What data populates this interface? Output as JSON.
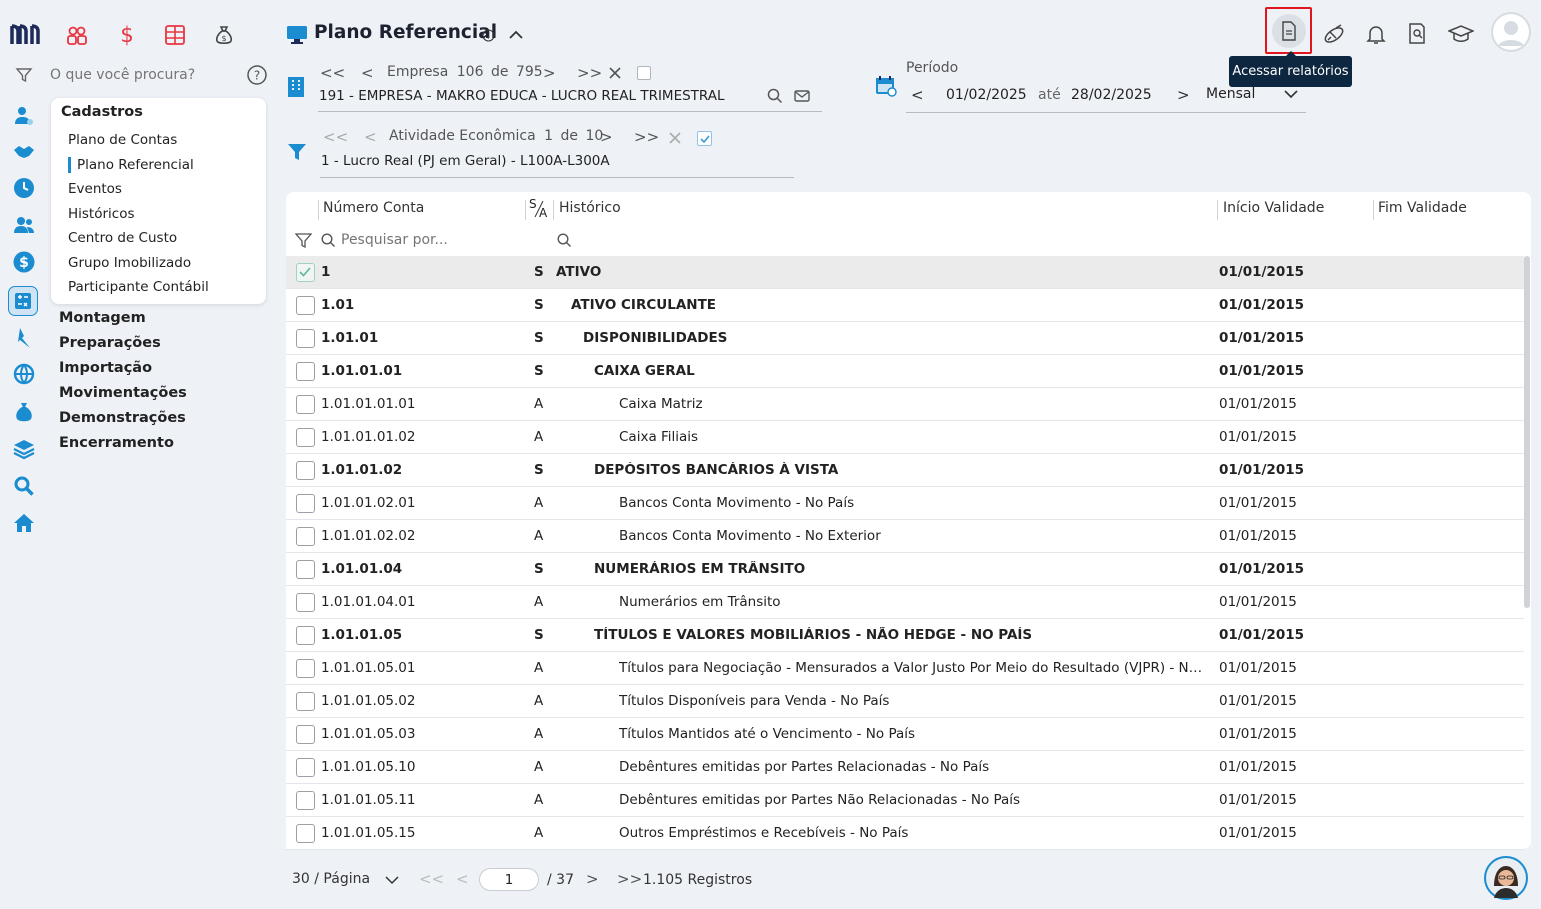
{
  "header": {
    "title": "Plano Referencial",
    "tooltip": "Acessar relatórios"
  },
  "search": {
    "placeholder": "O que você procura?"
  },
  "menu": {
    "group_title": "Cadastros",
    "items": [
      "Plano de Contas",
      "Plano Referencial",
      "Eventos",
      "Históricos",
      "Centro de Custo",
      "Grupo Imobilizado",
      "Participante Contábil"
    ],
    "sections": [
      "Montagem",
      "Preparações",
      "Importação",
      "Movimentações",
      "Demonstrações",
      "Encerramento"
    ]
  },
  "empresa": {
    "label": "Empresa",
    "current": "106",
    "of": "de",
    "total": "795",
    "name": "191 - EMPRESA - MAKRO EDUCA - LUCRO REAL TRIMESTRAL"
  },
  "atividade": {
    "label": "Atividade Econômica",
    "current": "1",
    "of": "de",
    "total": "10",
    "name": "1 - Lucro Real (PJ em Geral) - L100A-L300A"
  },
  "periodo": {
    "label": "Período",
    "start": "01/02/2025",
    "sep": "até",
    "end": "28/02/2025",
    "mode": "Mensal"
  },
  "table": {
    "columns": {
      "numero": "Número Conta",
      "sa_top": "S",
      "sa_bottom": "A",
      "historico": "Histórico",
      "inicio": "Início Validade",
      "fim": "Fim Validade"
    },
    "filter_placeholder": "Pesquisar por...",
    "rows": [
      {
        "num": "1",
        "sa": "S",
        "hist": "ATIVO",
        "dt": "01/01/2015",
        "lvl": 0,
        "bold": true,
        "checked": true
      },
      {
        "num": "1.01",
        "sa": "S",
        "hist": "ATIVO CIRCULANTE",
        "dt": "01/01/2015",
        "lvl": 1,
        "bold": true
      },
      {
        "num": "1.01.01",
        "sa": "S",
        "hist": "DISPONIBILIDADES",
        "dt": "01/01/2015",
        "lvl": 2,
        "bold": true
      },
      {
        "num": "1.01.01.01",
        "sa": "S",
        "hist": "CAIXA GERAL",
        "dt": "01/01/2015",
        "lvl": 3,
        "bold": true
      },
      {
        "num": "1.01.01.01.01",
        "sa": "A",
        "hist": "Caixa Matriz",
        "dt": "01/01/2015",
        "lvl": 4
      },
      {
        "num": "1.01.01.01.02",
        "sa": "A",
        "hist": "Caixa Filiais",
        "dt": "01/01/2015",
        "lvl": 4
      },
      {
        "num": "1.01.01.02",
        "sa": "S",
        "hist": "DEPÓSITOS BANCÁRIOS À VISTA",
        "dt": "01/01/2015",
        "lvl": 3,
        "bold": true
      },
      {
        "num": "1.01.01.02.01",
        "sa": "A",
        "hist": "Bancos Conta Movimento - No País",
        "dt": "01/01/2015",
        "lvl": 4
      },
      {
        "num": "1.01.01.02.02",
        "sa": "A",
        "hist": "Bancos Conta Movimento - No Exterior",
        "dt": "01/01/2015",
        "lvl": 4
      },
      {
        "num": "1.01.01.04",
        "sa": "S",
        "hist": "NUMERÁRIOS EM TRÂNSITO",
        "dt": "01/01/2015",
        "lvl": 3,
        "bold": true
      },
      {
        "num": "1.01.01.04.01",
        "sa": "A",
        "hist": "Numerários em Trânsito",
        "dt": "01/01/2015",
        "lvl": 4
      },
      {
        "num": "1.01.01.05",
        "sa": "S",
        "hist": "TÍTULOS E VALORES MOBILIÁRIOS - NÃO HEDGE - NO PAÍS",
        "dt": "01/01/2015",
        "lvl": 3,
        "bold": true
      },
      {
        "num": "1.01.01.05.01",
        "sa": "A",
        "hist": "Títulos para Negociação - Mensurados a Valor Justo Por Meio do Resultado (VJPR) - No País",
        "dt": "01/01/2015",
        "lvl": 4
      },
      {
        "num": "1.01.01.05.02",
        "sa": "A",
        "hist": "Títulos Disponíveis para Venda - No País",
        "dt": "01/01/2015",
        "lvl": 4
      },
      {
        "num": "1.01.01.05.03",
        "sa": "A",
        "hist": "Títulos Mantidos até o Vencimento - No País",
        "dt": "01/01/2015",
        "lvl": 4
      },
      {
        "num": "1.01.01.05.10",
        "sa": "A",
        "hist": "Debêntures emitidas por Partes Relacionadas - No País",
        "dt": "01/01/2015",
        "lvl": 4
      },
      {
        "num": "1.01.01.05.11",
        "sa": "A",
        "hist": "Debêntures emitidas por Partes Não Relacionadas - No País",
        "dt": "01/01/2015",
        "lvl": 4
      },
      {
        "num": "1.01.01.05.15",
        "sa": "A",
        "hist": "Outros Empréstimos e Recebíveis - No País",
        "dt": "01/01/2015",
        "lvl": 4
      }
    ]
  },
  "pagination": {
    "per_page": "30 / Página",
    "page": "1",
    "total_pages": "/ 37",
    "records": "1.105 Registros"
  },
  "colors": {
    "accent": "#1a8ccf",
    "brand": "#1d2a5a",
    "danger": "#e8353f"
  }
}
